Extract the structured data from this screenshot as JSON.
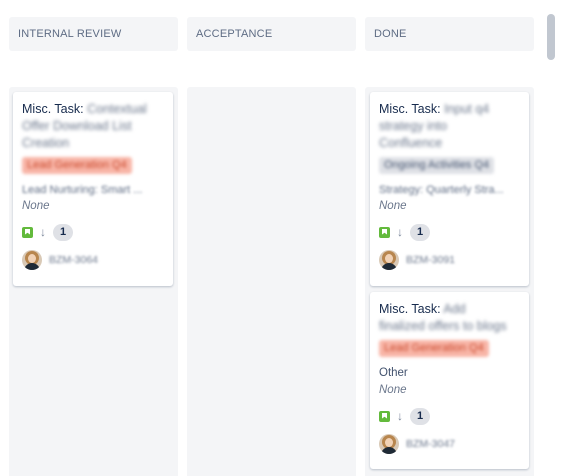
{
  "columns": [
    {
      "name": "INTERNAL REVIEW"
    },
    {
      "name": "ACCEPTANCE"
    },
    {
      "name": "DONE"
    }
  ],
  "cards": [
    {
      "title_prefix": "Misc. Task:",
      "title_line1": "Contextual",
      "title_line2": "Offer Download List",
      "title_line3": "Creation",
      "epic": "Lead Generation Q4",
      "epic_bg": "#f8b5a7",
      "epic_color": "#c9472a",
      "field1": "Lead Nurturing: Smart ...",
      "field2": "None",
      "priority": "low",
      "badge": "1",
      "key": "BZM-3064"
    },
    {
      "title_prefix": "Misc. Task:",
      "title_line1": "Input q4",
      "title_line2": "strategy into",
      "title_line3": "Confluence",
      "epic": "Ongoing Activities Q4",
      "epic_bg": "#dfe1e6",
      "epic_color": "#42526e",
      "field1": "Strategy: Quarterly Stra...",
      "field2": "None",
      "priority": "low",
      "badge": "1",
      "key": "BZM-3091"
    },
    {
      "title_prefix": "Misc. Task:",
      "title_line1": "Add",
      "title_line2": "finalized offers to blogs",
      "epic": "Lead Generation Q4",
      "epic_bg": "#f8b5a7",
      "epic_color": "#c9472a",
      "field1": "Other",
      "field2": "None",
      "priority": "low",
      "badge": "1",
      "key": "BZM-3047"
    }
  ],
  "colors": {
    "column_bg": "#f4f5f7",
    "story_icon": "#63ba3c",
    "text": "#172b4d"
  },
  "icons": {
    "issue_type": "story-bookmark-icon",
    "priority": "arrow-down-icon"
  }
}
